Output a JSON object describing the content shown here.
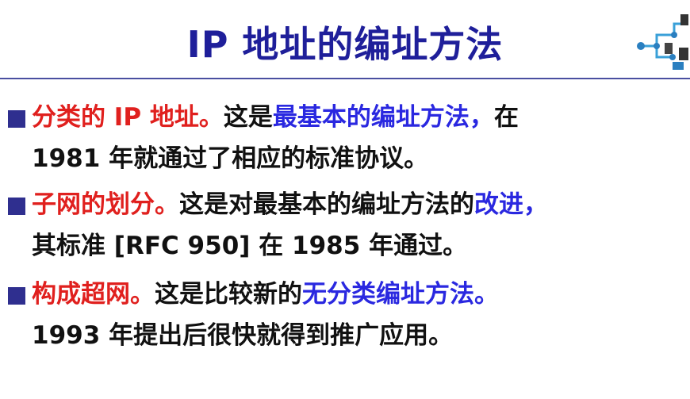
{
  "title": "IP 地址的编址方法",
  "items": [
    {
      "line1": [
        {
          "text": "分类的 IP 地址。",
          "color": "red"
        },
        {
          "text": "这是",
          "color": "black"
        },
        {
          "text": "最基本的编址方法，",
          "color": "blue"
        },
        {
          "text": "在",
          "color": "black"
        }
      ],
      "line2": "1981 年就通过了相应的标准协议。"
    },
    {
      "line1": [
        {
          "text": "子网的划分。",
          "color": "red"
        },
        {
          "text": "这是对最基本的编址方法的",
          "color": "black"
        },
        {
          "text": "改进，",
          "color": "blue"
        }
      ],
      "line2": "其标准 [RFC 950] 在 1985 年通过。"
    },
    {
      "line1": [
        {
          "text": "构成超网。",
          "color": "red"
        },
        {
          "text": "这是比较新的",
          "color": "black"
        },
        {
          "text": "无分类编址方法。",
          "color": "blue"
        }
      ],
      "line2": "1993 年提出后很快就得到推广应用。"
    }
  ],
  "colors": {
    "title": "#1f1f9a",
    "red": "#e0201e",
    "blue": "#2a28e0",
    "bullet": "#2f2f8f",
    "rule": "#4a4fa0"
  },
  "icons": {
    "logo": "network-computers-icon",
    "bullet": "square-bullet-icon"
  }
}
